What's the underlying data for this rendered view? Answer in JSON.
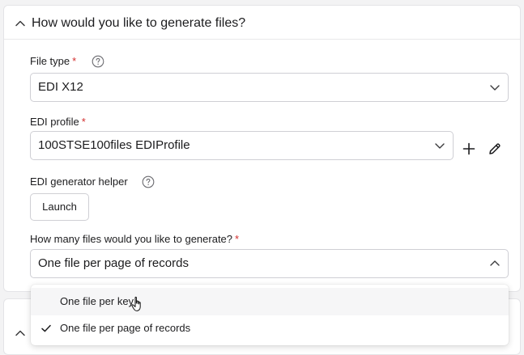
{
  "section": {
    "title": "How would you like to generate files?"
  },
  "file_type": {
    "label": "File type",
    "required_mark": "*",
    "value": "EDI X12"
  },
  "edi_profile": {
    "label": "EDI profile",
    "required_mark": "*",
    "value": "100STSE100files EDIProfile"
  },
  "edi_generator_helper": {
    "label": "EDI generator helper",
    "launch_label": "Launch"
  },
  "files_count": {
    "label": "How many files would you like to generate?",
    "required_mark": "*",
    "value": "One file per page of records",
    "options": [
      {
        "label": "One file per key",
        "selected": false
      },
      {
        "label": "One file per page of records",
        "selected": true
      }
    ]
  },
  "colors": {
    "required": "#d32f2f",
    "border": "#cfcfd4",
    "icon": "#3a3a3c"
  },
  "icons": [
    "chevron-up-icon",
    "help-icon",
    "chevron-down-icon",
    "plus-icon",
    "pencil-icon",
    "check-icon",
    "hand-cursor-icon"
  ]
}
